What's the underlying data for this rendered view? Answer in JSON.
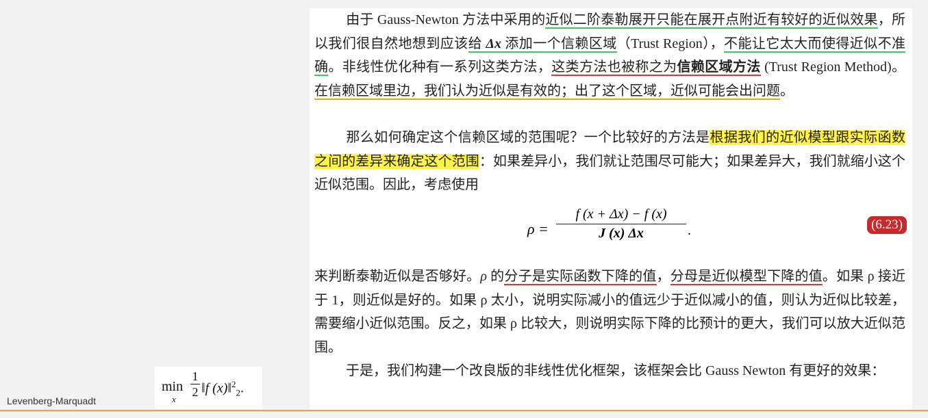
{
  "paragraphs": {
    "p1": {
      "t1": "由于 Gauss-Newton 方法中采用的",
      "u1": "近似二阶泰勒展开只能在展开点附近有较好的近似效果",
      "t2": "，所以我们很自然地想到应该",
      "u2a": "给 ",
      "dx": "Δx",
      "u2b": " 添加一个信赖区域",
      "t3": "（Trust Region），",
      "u3": "不能让它太大而使得近似不准确",
      "t4": "。非线性优化种有一系列这类方法，",
      "u4": "这类方法也被称之为",
      "u4b": "信赖区域方法",
      "t5": " (Trust Region Method)。",
      "u5": "在信赖区域里边，我们认为近似是有效的；出了这个区域，近似可能会出问题",
      "t6": "。"
    },
    "p2": {
      "t1": "那么如何确定这个信赖区域的范围呢？一个比较好的方法是",
      "h1": "根据我们的近似模型跟实际函数之间的差异来确定这个范围",
      "t2": "：如果差异小，我们就让范围尽可能大；如果差异大，我们就缩小这个近似范围。因此，考虑使用"
    },
    "equation": {
      "lhs": "ρ =",
      "numerator": "f (x + Δx) − f (x)",
      "denominator": "J (x) Δx",
      "trail": ".",
      "number": "(6.23)"
    },
    "p3": {
      "t1": "来判断泰勒近似是否够好。",
      "rho": "ρ",
      "t2": " 的",
      "u1": "分子是实际函数下降的值",
      "t3": "，",
      "u2": "分母是近似模型下降的值",
      "t4": "。如果 ρ 接近于 1，则近似是好的。如果 ρ 太小，说明实际减小的值远少于近似减小的值，则认为近似比较差，需要缩小近似范围。反之，如果 ρ 比较大，则说明实际下降的比预计的更大，我们可以放大近似范围。"
    },
    "p4": {
      "t1": "于是，我们构建一个改良版的非线性优化框架，该框架会比 Gauss Newton 有更好的效果："
    }
  },
  "side_formula": {
    "min": "min",
    "sub": "x",
    "half_num": "1",
    "half_den": "2",
    "norm": "‖f (x)‖",
    "sub2": "2",
    "sup2": "2",
    "trail": "."
  },
  "side_label": "Levenberg-Marquadt",
  "colors": {
    "green_underline": "#3cc85a",
    "red_underline": "#d23a3a",
    "yellow_underline": "#e0b000",
    "highlight": "#fff34a",
    "equation_badge": "#c62a2a",
    "accent_bottom": "#f0a040"
  }
}
